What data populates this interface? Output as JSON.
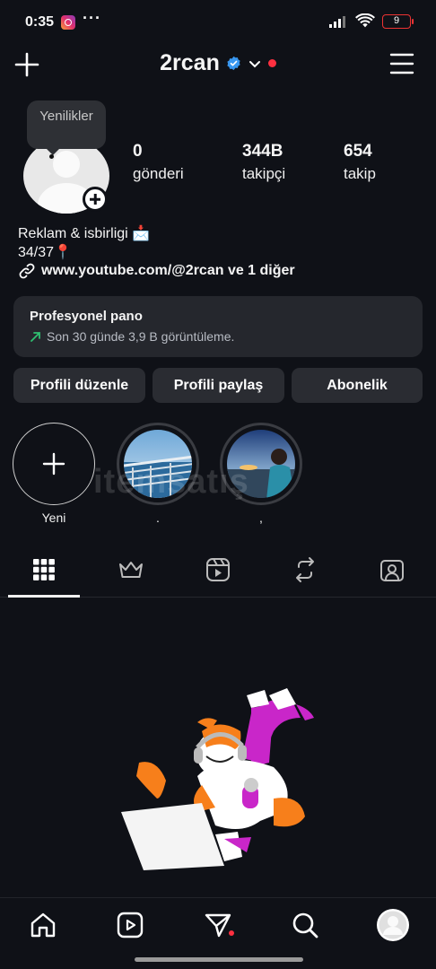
{
  "status_bar": {
    "time": "0:35",
    "dots": "···",
    "battery": "9",
    "app_icon": "instagram-icon",
    "signal_icon": "signal-icon",
    "wifi_icon": "wifi-icon",
    "battery_color": "#e33333"
  },
  "header": {
    "username": "2rcan",
    "verified_icon": "verified-icon",
    "notification_color": "#ff3040"
  },
  "profile": {
    "tooltip": "Yenilikler",
    "stats": [
      {
        "value": "0",
        "label": "gönderi"
      },
      {
        "value": "344B",
        "label": "takipçi"
      },
      {
        "value": "654",
        "label": "takip"
      }
    ],
    "bio_line1": "Reklam & isbirligi 📩",
    "bio_line2": "34/37📍",
    "link": "www.youtube.com/@2rcan ve 1 diğer"
  },
  "dashboard": {
    "title": "Profesyonel pano",
    "subtitle": "Son 30 günde 3,9 B görüntüleme.",
    "trend_color": "#2fbf71"
  },
  "actions": {
    "edit": "Profili düzenle",
    "share": "Profili paylaş",
    "subscription": "Abonelik"
  },
  "highlights": [
    {
      "label": "Yeni"
    },
    {
      "label": "."
    },
    {
      "label": ","
    }
  ],
  "watermark": "itemsatış",
  "tabs": [
    "grid-icon",
    "crown-icon",
    "reels-icon",
    "reposts-icon",
    "tagged-icon"
  ],
  "colors": {
    "background": "#0f1117",
    "card": "#25272d",
    "button": "#2a2c32",
    "verified": "#3897f0",
    "accent_pink": "#c926c9",
    "accent_orange": "#f77f1b"
  }
}
